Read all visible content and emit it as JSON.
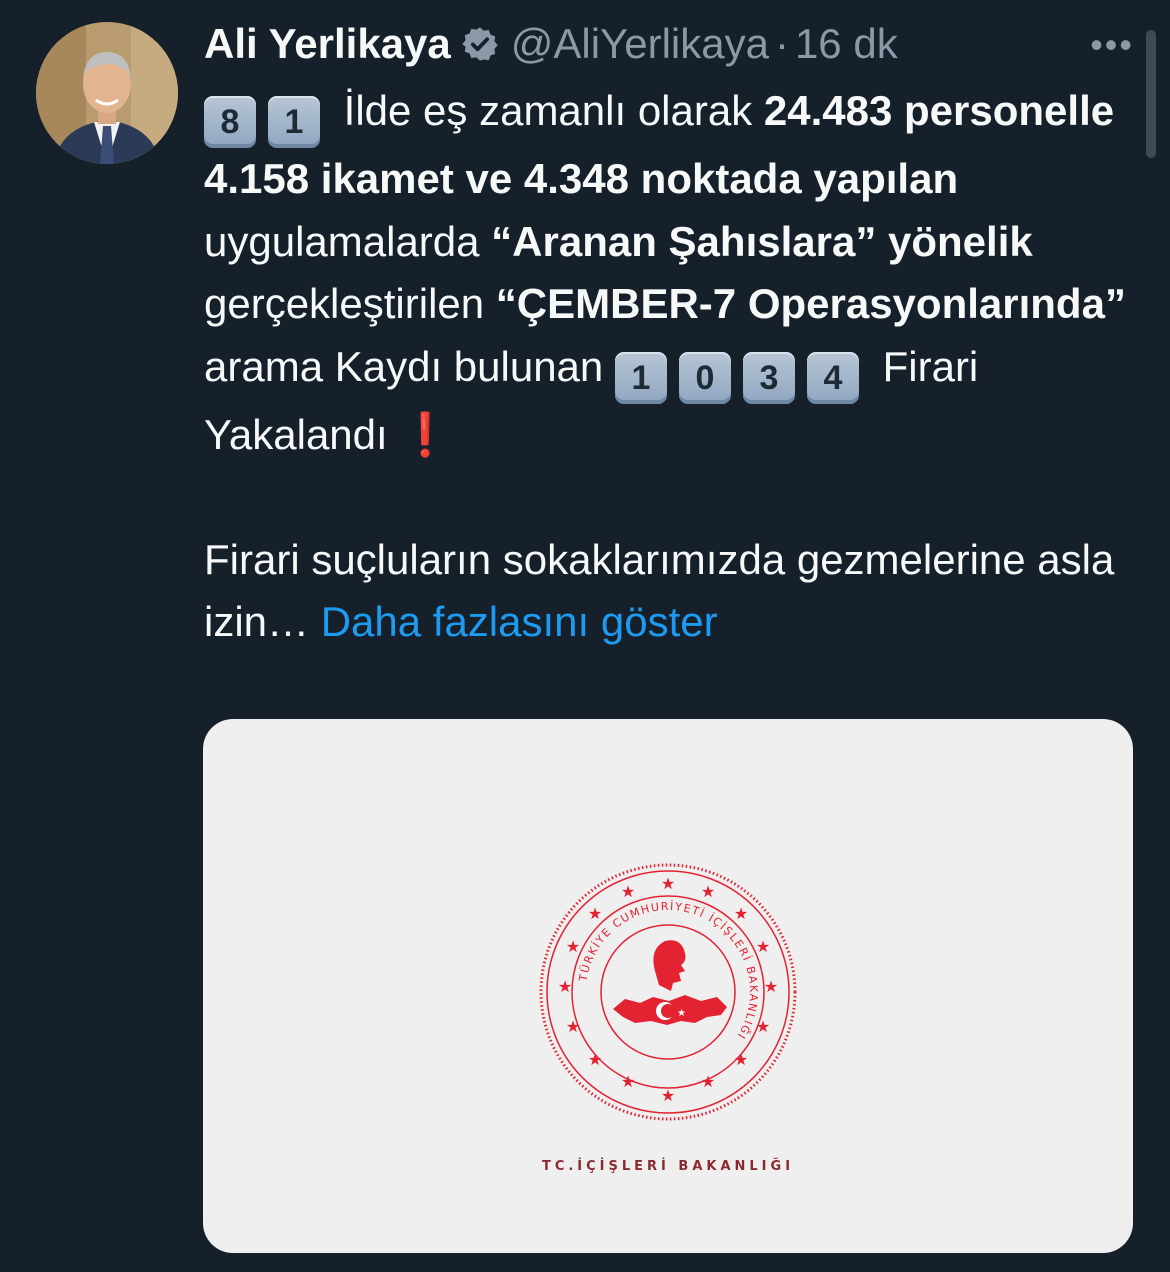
{
  "tweet": {
    "author_name": "Ali Yerlikaya",
    "handle": "@AliYerlikaya",
    "separator": "·",
    "time": "16 dk",
    "more": "•••",
    "keycaps_prefix": [
      "8",
      "1"
    ],
    "p1_a": "İlde eş zamanlı olarak ",
    "p1_b": "24.483 personelle 4.158 ikamet ve 4.348 noktada yapılan",
    "p1_c": " uygulamalarda ",
    "p1_d": "“Aranan Şahıslara” yönelik",
    "p1_e": " gerçekleştirilen ",
    "p1_f": "“ÇEMBER-7 Operasyonlarında”",
    "p1_g": " arama Kaydı bulunan ",
    "keycaps_count": [
      "1",
      "0",
      "3",
      "4"
    ],
    "p1_h": " Firari Yakalandı ",
    "p1_excl": "❗",
    "p2": "Firari suçluların sokaklarımızda gezmelerine asla izin… ",
    "show_more": "Daha fazlasını göster"
  },
  "media": {
    "seal_ring_text": "TÜRKİYE CUMHURİYETİ İÇİŞLERİ BAKANLIĞI",
    "caption": "TC.İÇİŞLERİ BAKANLIĞI"
  },
  "colors": {
    "background": "#15202b",
    "text": "#f7f9f9",
    "muted": "#8b98a5",
    "link": "#1d9bf0",
    "seal_red": "#e32232"
  }
}
